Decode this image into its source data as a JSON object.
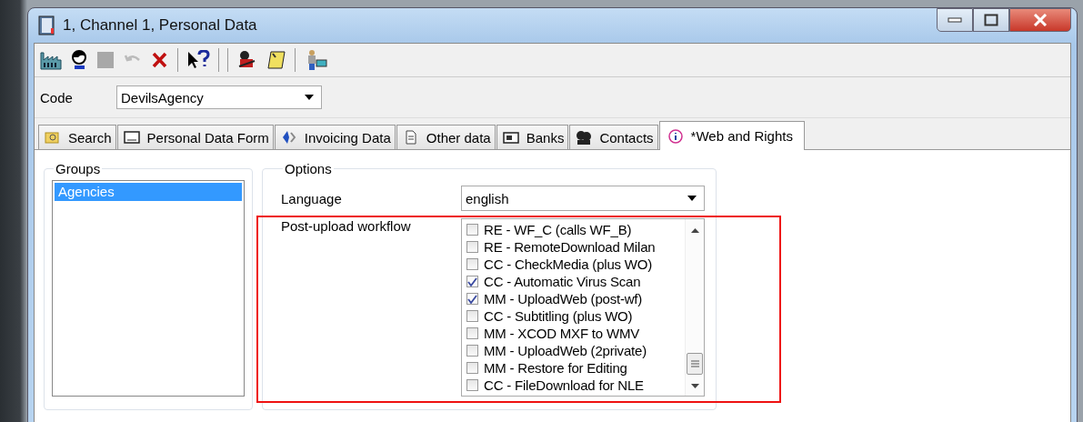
{
  "window": {
    "title": "1, Channel 1, Personal Data"
  },
  "code_field": {
    "label": "Code",
    "value": "DevilsAgency"
  },
  "tabs": [
    {
      "label": "Search",
      "selected": false,
      "kind": "search"
    },
    {
      "label": "Personal Data Form",
      "selected": false,
      "kind": "form"
    },
    {
      "label": "Invoicing Data",
      "selected": false,
      "kind": "invoice"
    },
    {
      "label": "Other data",
      "selected": false,
      "kind": "document"
    },
    {
      "label": "Banks",
      "selected": false,
      "kind": "bank"
    },
    {
      "label": "Contacts",
      "selected": false,
      "kind": "contacts"
    },
    {
      "label": "*Web and Rights",
      "selected": true,
      "kind": "info"
    }
  ],
  "groups": {
    "title": "Groups",
    "items": [
      {
        "label": "Agencies",
        "selected": true
      }
    ]
  },
  "options": {
    "title": "Options",
    "language": {
      "label": "Language",
      "value": "english"
    },
    "workflow": {
      "label": "Post-upload workflow",
      "items": [
        {
          "label": "RE - WF_C (calls WF_B)",
          "checked": false
        },
        {
          "label": "RE - RemoteDownload Milan",
          "checked": false
        },
        {
          "label": "CC - CheckMedia (plus WO)",
          "checked": false
        },
        {
          "label": "CC - Automatic Virus Scan",
          "checked": true
        },
        {
          "label": "MM - UploadWeb (post-wf)",
          "checked": true
        },
        {
          "label": "CC - Subtitling (plus WO)",
          "checked": false
        },
        {
          "label": "MM - XCOD MXF to WMV",
          "checked": false
        },
        {
          "label": "MM - UploadWeb (2private)",
          "checked": false
        },
        {
          "label": "MM - Restore for Editing",
          "checked": false
        },
        {
          "label": "CC - FileDownload for NLE",
          "checked": false
        }
      ]
    }
  }
}
